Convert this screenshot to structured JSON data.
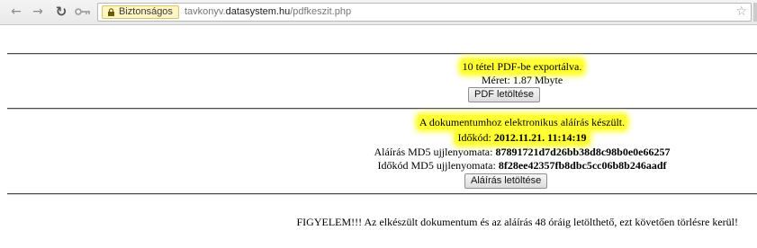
{
  "browser": {
    "secure_label": "Biztonságos",
    "url_prefix": "tavkonyv.",
    "url_domain": "datasystem.hu",
    "url_path": "/pdfkeszit.php"
  },
  "export": {
    "message": "10 tétel PDF-be exportálva.",
    "size_text": "Méret: 1.87 Mbyte",
    "download_label": "PDF letöltése"
  },
  "signature": {
    "message": "A dokumentumhoz elektronikus aláírás készült.",
    "timestamp_label": "Időkód: ",
    "timestamp_value": "2012.11.21. 11:14:19",
    "signature_md5_label": "Aláírás MD5 ujjlenyomata: ",
    "signature_md5_value": "87891721d7d26bb38d8c98b0e0e66257",
    "timestamp_md5_label": "Időkód MD5 ujjlenyomata: ",
    "timestamp_md5_value": "8f28ee42357fb8dbc5cc06b8b246aadf",
    "download_label": "Aláírás letöltése"
  },
  "warning": "FIGYELEM!!! Az elkészült dokumentum és az aláírás 48 óráig letölthető, ezt követően törlésre kerül!",
  "colors": {
    "highlight": "#ffff33",
    "secure_chip": "#fff6c4"
  },
  "icons": [
    "back-arrow-icon",
    "forward-arrow-icon",
    "reload-icon",
    "key-icon",
    "lock-icon",
    "star-icon"
  ]
}
